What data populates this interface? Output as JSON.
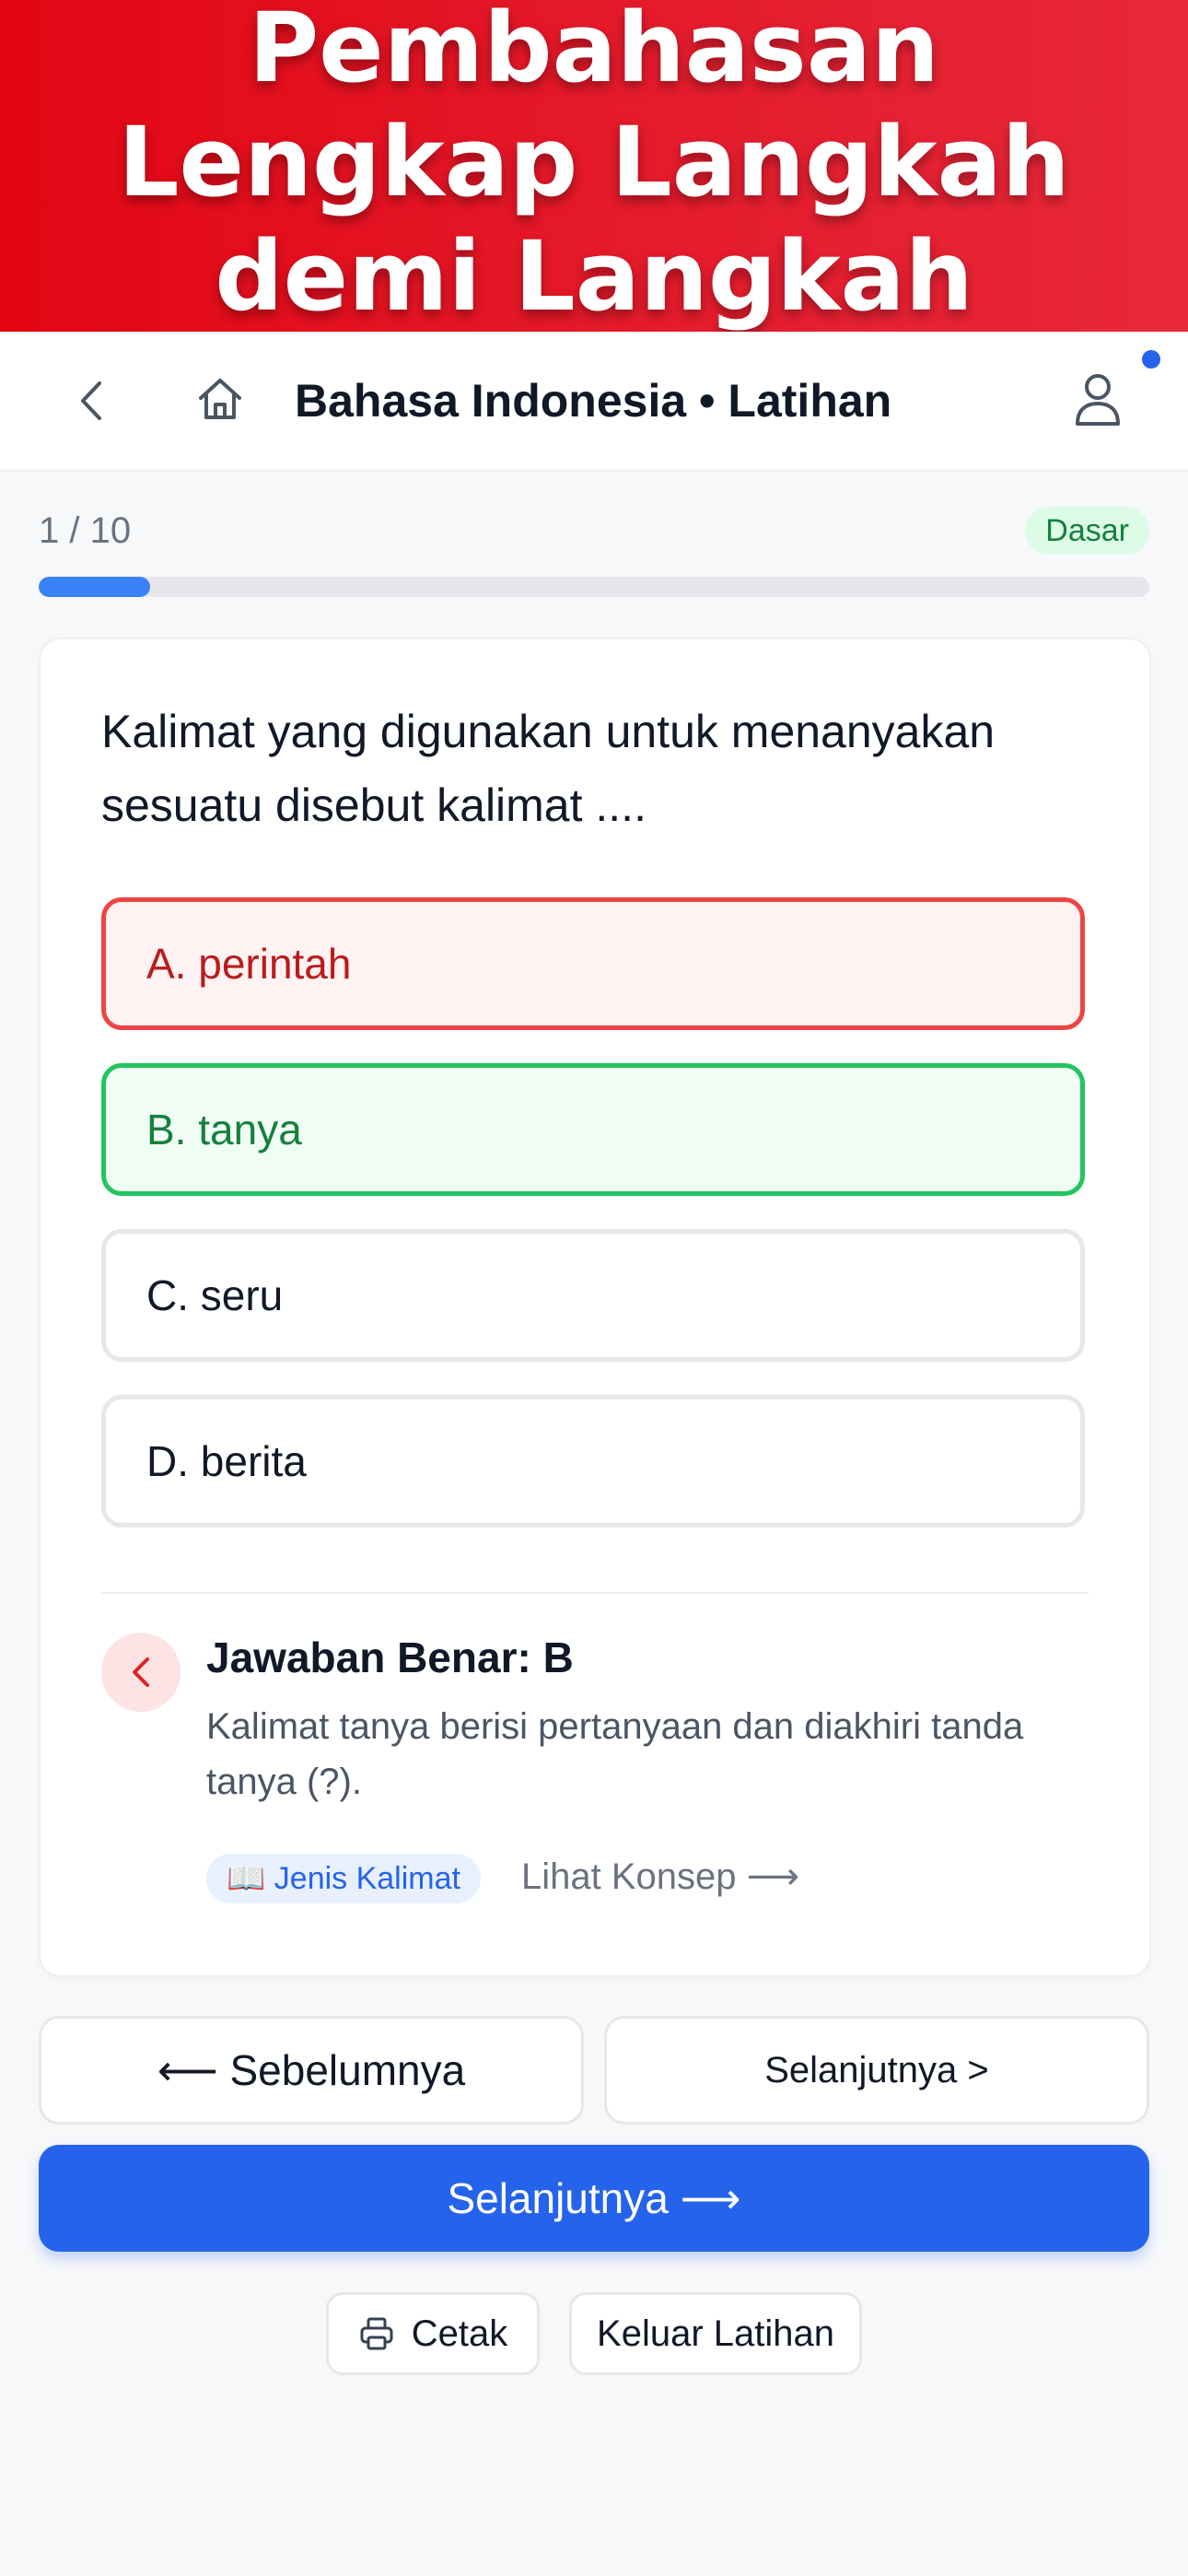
{
  "banner": {
    "title": "Pembahasan Lengkap Langkah demi Langkah"
  },
  "topbar": {
    "title": "Bahasa Indonesia • Latihan",
    "icons": [
      "back-icon",
      "home-icon",
      "user-icon"
    ]
  },
  "progress": {
    "count": "1 / 10",
    "level": "Dasar",
    "fraction": 0.1
  },
  "question": {
    "text": "Kalimat yang digunakan untuk menanyakan sesuatu disebut kalimat ....",
    "options": [
      {
        "label": "A. perintah",
        "state": "wrong"
      },
      {
        "label": "B. tanya",
        "state": "correct"
      },
      {
        "label": "C. seru",
        "state": "neutral"
      },
      {
        "label": "D. berita",
        "state": "neutral"
      }
    ]
  },
  "explanation": {
    "title": "Jawaban Benar: B",
    "text": "Kalimat tanya berisi pertanyaan dan diakhiri tanda tanya (?).",
    "concept_tag": "📖 Jenis Kalimat",
    "concept_link": "Lihat Konsep ⟶"
  },
  "navigation": {
    "prev_label": "⟵ Sebelumnya",
    "next_label": "Selanjutnya >",
    "primary_label": "Selanjutnya ⟶",
    "print_label": "Cetak",
    "exit_label": "Keluar Latihan"
  },
  "colors": {
    "banner": "#e30613",
    "accent": "#2563eb",
    "wrong": "#ef4444",
    "correct": "#22c55e",
    "level_badge_bg": "#dcfce7"
  }
}
